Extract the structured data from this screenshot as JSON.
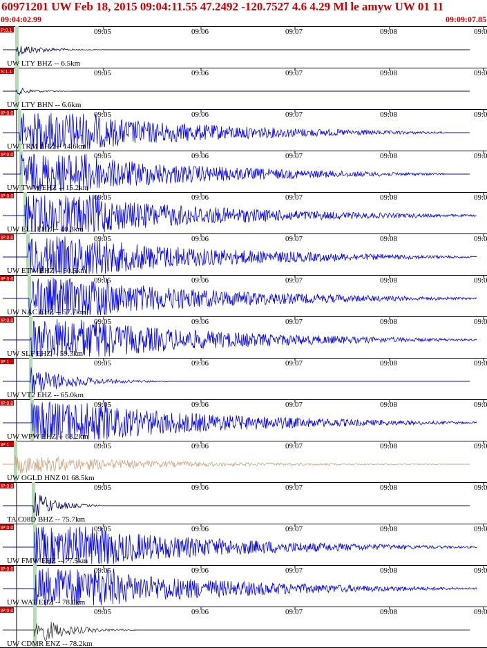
{
  "header": {
    "title": "60971201 UW Feb 18, 2015 09:04:11.55   47.2492 -120.7527  4.6 4.29 Ml le amyw UW 01  11",
    "start_time": "09:04:02.99",
    "end_time": "09:09:07.85"
  },
  "colors": {
    "header_text": "#cc0000",
    "trace_blue": "#0000ee",
    "trace_dark": "#000055",
    "trace_tan": "#c8a07a",
    "trace_black": "#333333",
    "pick": "#cc0000",
    "pick_band": "#b6d9b6"
  },
  "chart_data": {
    "type": "seismogram",
    "time_ticks": [
      "09:05",
      "09:06",
      "09:07",
      "09:08",
      "09:09"
    ],
    "traces": [
      {
        "label": "UW LTY BHZ -- 6.5km",
        "pick_label": "P:0.1",
        "color": "dark",
        "amplitude": "low",
        "coda_end": "09:05"
      },
      {
        "label": "UW LTY BHN -- 6.6km",
        "pick_label": "S:1.1",
        "color": "dark",
        "amplitude": "very-low",
        "coda_end": "09:04:40"
      },
      {
        "label": "UW TRM EHZ -- 14.6km",
        "pick_label": "IP:0.0",
        "color": "blue",
        "amplitude": "clipped",
        "coda_end": "09:08:30"
      },
      {
        "label": "UW TWW EHZ -- 15.2km",
        "pick_label": "IP:0.0",
        "color": "blue",
        "amplitude": "clipped",
        "coda_end": "09:08:30"
      },
      {
        "label": "UW ELL EHZ -- 40.3km",
        "pick_label": "IP:0.0",
        "color": "blue",
        "amplitude": "clipped",
        "coda_end": "09:09"
      },
      {
        "label": "UW ETW EHZ -- 50.5km",
        "pick_label": "IP:0.0",
        "color": "blue",
        "amplitude": "clipped",
        "coda_end": "09:09"
      },
      {
        "label": "UW NAC EHZ -- 57.7km",
        "pick_label": "IP:0.0",
        "color": "blue",
        "amplitude": "clipped",
        "coda_end": "09:09"
      },
      {
        "label": "UW SLF EHZ -- 59.3km",
        "pick_label": "IP:0.0",
        "color": "blue",
        "amplitude": "clipped",
        "coda_end": "09:09"
      },
      {
        "label": "UW VT2 EHZ -- 65.0km",
        "pick_label": "IP:1",
        "color": "blue",
        "amplitude": "high",
        "coda_end": "09:05:40"
      },
      {
        "label": "UW WPW EHZ -- 68.2km",
        "pick_label": "IP:0.0",
        "color": "blue",
        "amplitude": "clipped",
        "coda_end": "09:09"
      },
      {
        "label": "UW OGLD HNZ 01 68.5km",
        "pick_label": "IP:1",
        "color": "tan",
        "amplitude": "medium",
        "coda_end": "09:08:30"
      },
      {
        "label": "TA C08D BHZ -- 75.7km",
        "pick_label": "IP:0.0",
        "color": "dark",
        "amplitude": "high",
        "coda_end": "09:05"
      },
      {
        "label": "UW FMW EHZ -- 77.5km",
        "pick_label": "IP:0.0",
        "color": "blue",
        "amplitude": "clipped",
        "coda_end": "09:09"
      },
      {
        "label": "UW WAT EHZ -- 78.0km",
        "pick_label": "IP:0.0",
        "color": "blue",
        "amplitude": "clipped",
        "coda_end": "09:09"
      },
      {
        "label": "UW CDMR ENZ -- 78.2km",
        "pick_label": "IP:0.0",
        "color": "black",
        "amplitude": "high",
        "coda_end": "09:05:20"
      }
    ]
  }
}
